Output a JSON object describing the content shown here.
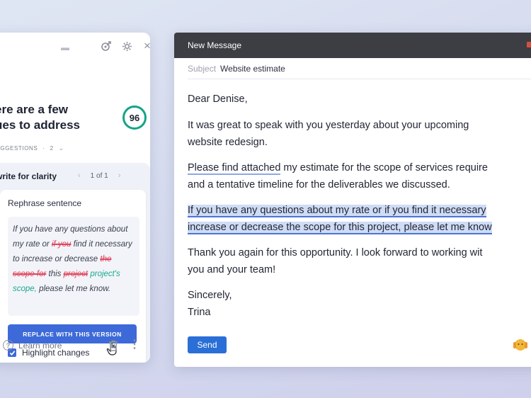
{
  "panel": {
    "headline": "ere are a few\nues to address",
    "score": "96",
    "suggestions_label": "UGGESTIONS",
    "suggestions_count": "2",
    "group_title": "write for clarity",
    "pager_text": "1 of 1",
    "card_title": "Rephrase sentence",
    "quote": {
      "t1": "If you have any questions about my rate or ",
      "del1": "if you",
      "t2": " find it necessary to increase or decrease ",
      "del2": "the scope for",
      "t3": " this ",
      "del3": "project",
      "ins1": "project's scope,",
      "t4": " please let me know."
    },
    "replace_button": "REPLACE WITH THIS VERSION",
    "highlight_changes": "Highlight changes",
    "learn_more": "Learn more"
  },
  "compose": {
    "window_title": "New Message",
    "subject_label": "Subject",
    "subject_value": "Website estimate",
    "greeting": "Dear Denise,",
    "p1_line1": "It was great to speak with you yesterday about your upcoming",
    "p1_line2": "website redesign.",
    "p2_underlined": "Please find attached",
    "p2_line1_rest": " my estimate for the scope of services require",
    "p2_line2": "and a tentative timeline for the deliverables we discussed.",
    "p3_line1": "If you have any questions about my rate or if you find it necessary",
    "p3_line2": "increase or decrease the scope for this project, please let me know",
    "p4_line1": "Thank you again for this opportunity. I look forward to working wit",
    "p4_line2": "you and your team!",
    "signoff": "Sincerely,",
    "signature": "Trina",
    "send_button": "Send"
  },
  "colors": {
    "accent_blue": "#3d6ad8",
    "score_ring": "#16a386",
    "deletion": "#e0455b",
    "insertion": "#1aa98c",
    "highlight": "#cfdcf6"
  }
}
